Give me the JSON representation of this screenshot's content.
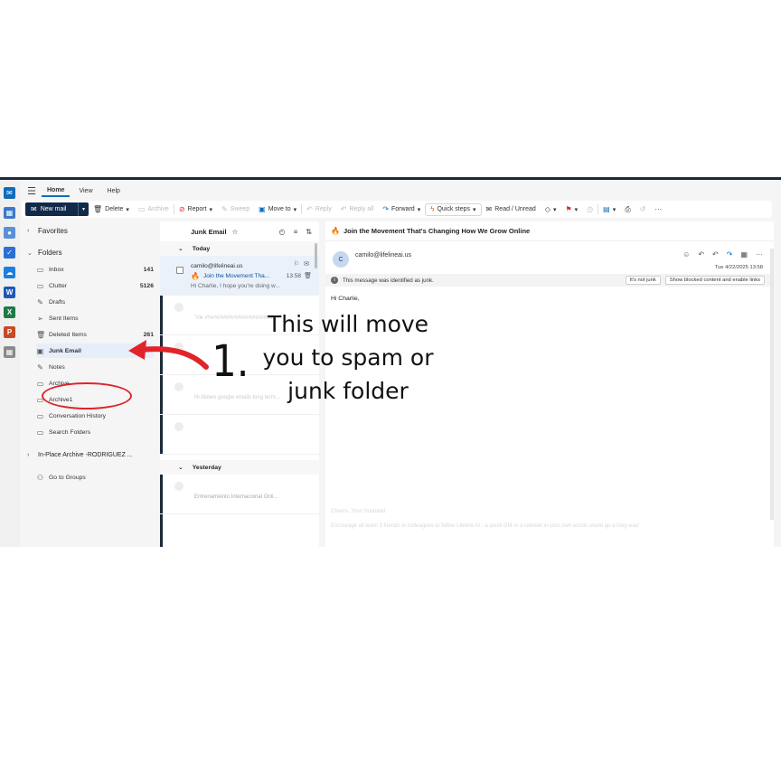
{
  "ribbon": {
    "tabs": [
      "Home",
      "View",
      "Help"
    ],
    "new_mail": "New mail",
    "delete": "Delete",
    "archive": "Archive",
    "report": "Report",
    "sweep": "Sweep",
    "move_to": "Move to",
    "reply": "Reply",
    "reply_all": "Reply all",
    "forward": "Forward",
    "quick_steps": "Quick steps",
    "read_unread": "Read / Unread"
  },
  "folders": {
    "favorites": "Favorites",
    "folders": "Folders",
    "items": [
      {
        "label": "Inbox",
        "count": "141"
      },
      {
        "label": "Clutter",
        "count": "5126"
      },
      {
        "label": "Drafts",
        "count": ""
      },
      {
        "label": "Sent Items",
        "count": ""
      },
      {
        "label": "Deleted Items",
        "count": "261"
      },
      {
        "label": "Junk Email",
        "count": ""
      },
      {
        "label": "Notes",
        "count": ""
      },
      {
        "label": "Archive",
        "count": ""
      },
      {
        "label": "Archive1",
        "count": ""
      },
      {
        "label": "Conversation History",
        "count": ""
      },
      {
        "label": "Search Folders",
        "count": ""
      }
    ],
    "archive_section": "In-Place Archive -RODRIGUEZ ...",
    "groups": "Go to Groups"
  },
  "list": {
    "title": "Junk Email",
    "group_today": "Today",
    "group_yesterday": "Yesterday",
    "selected": {
      "sender": "camilo@lifelineai.us",
      "subject": "Join the Movement Tha...",
      "time": "13:58",
      "preview": "Hi Charlie, I hope you're doing w..."
    },
    "faded_1": "\"ink #%r%%%%%%%%%%%%\"",
    "faded_3": "Hi Allows google emails long term...",
    "faded_4": "Entrenamiento Internacional Onli..."
  },
  "reading": {
    "subject": "Join the Movement That's Changing How We Grow Online",
    "from": "camilo@lifelineai.us",
    "avatar": "C",
    "date": "Tue 4/22/2025 13:58",
    "junk_notice": "This message was identified as junk.",
    "not_junk": "It's not junk",
    "show_blocked": "Show blocked content and enable links",
    "greeting": "Hi Charlie,",
    "ghost_1": "Cheers, Your Husband",
    "ghost_2": "Encourage all team 3 friends or colleagues to follow Lifeline AI - a quick DM or a retweet in your own words would go a long way!"
  },
  "annotation": {
    "text_1": "This will move",
    "text_2": "you to spam or",
    "text_3": "junk folder",
    "number": "1."
  },
  "colors": {
    "brand": "#11294a",
    "accent": "#0f6cbd",
    "highlight": "#e0242a"
  }
}
